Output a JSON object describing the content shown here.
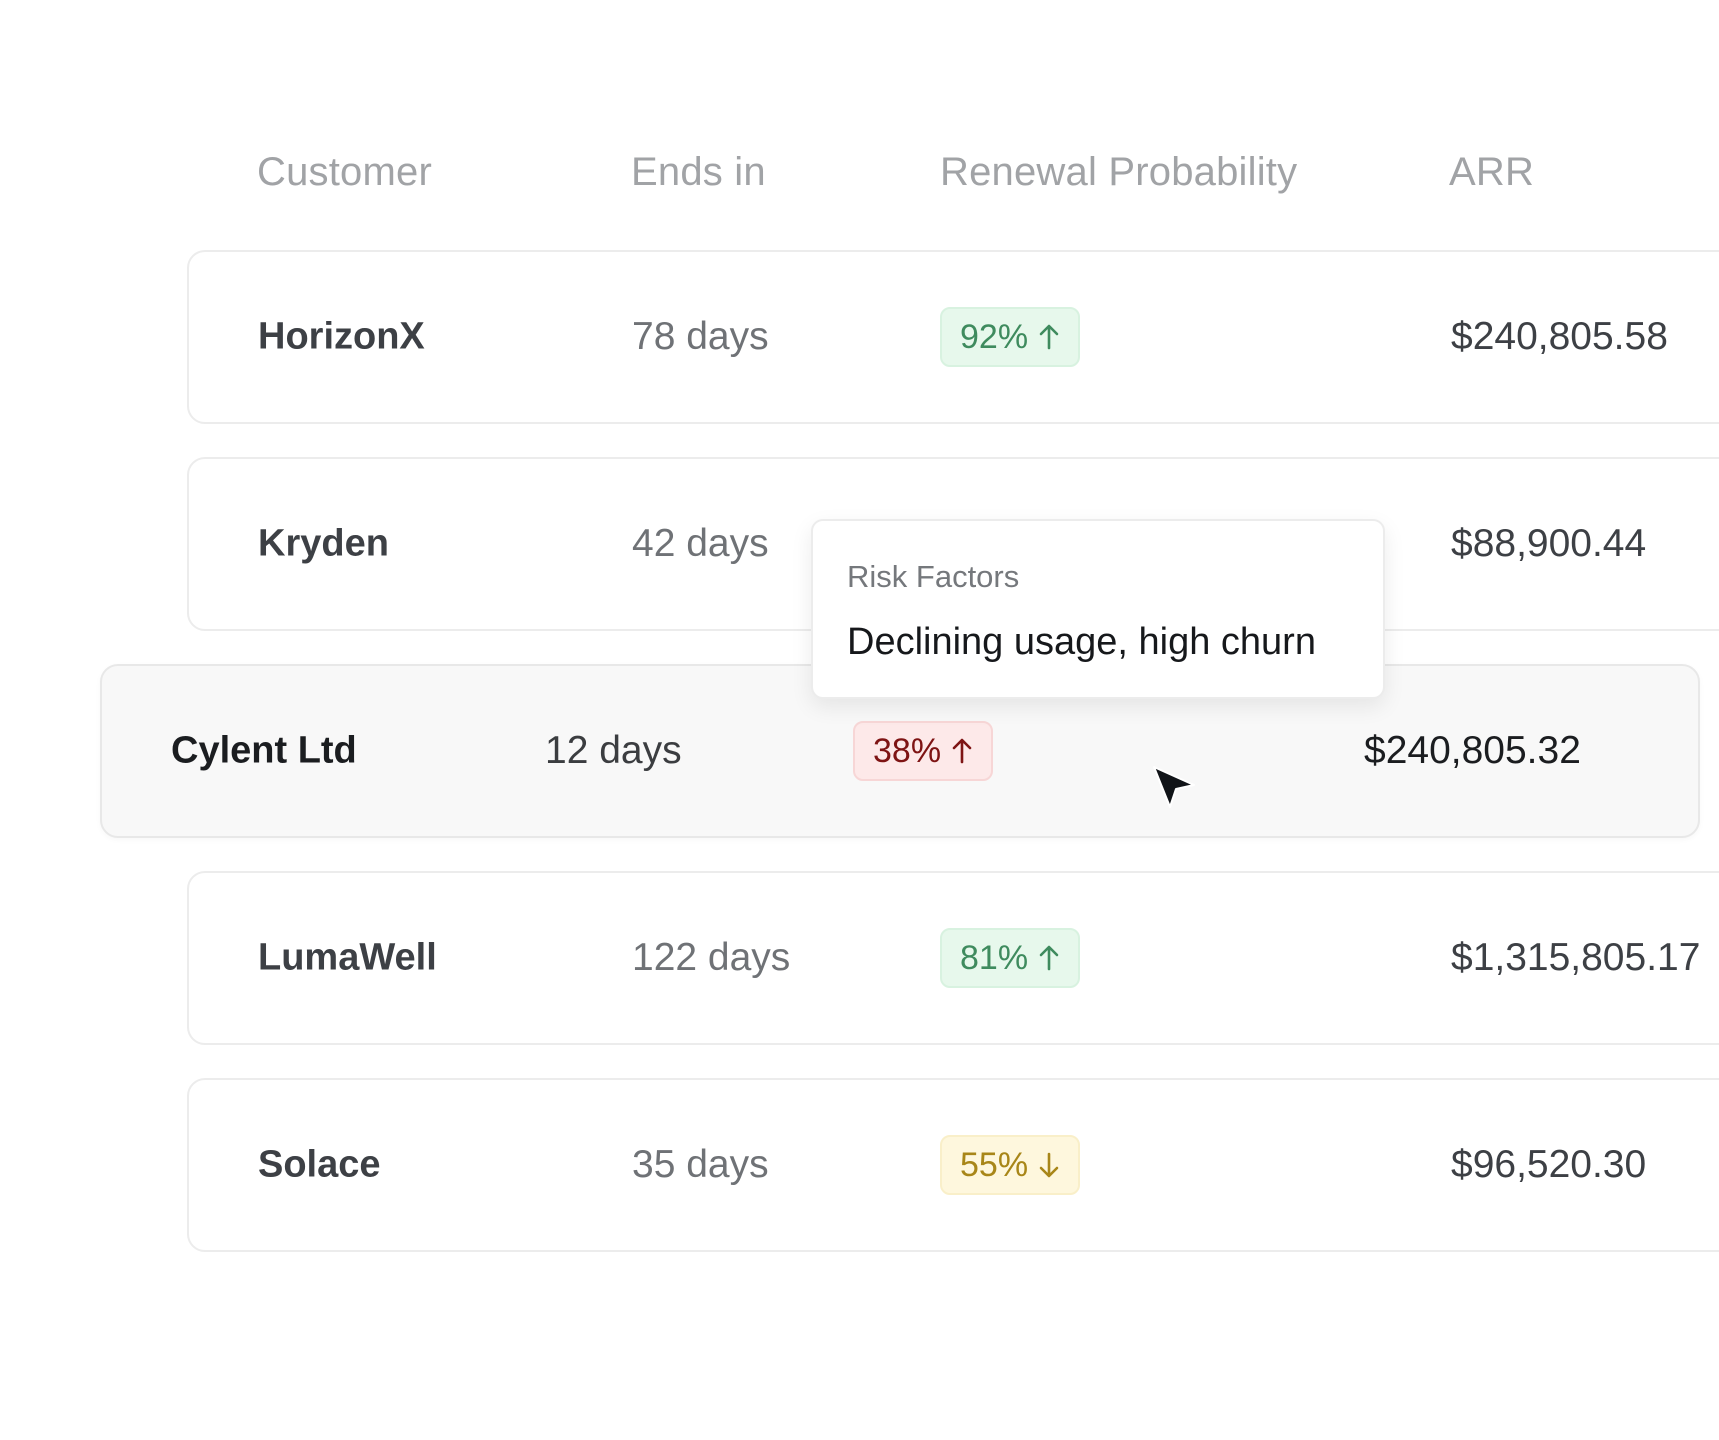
{
  "table": {
    "headers": {
      "customer": "Customer",
      "ends_in": "Ends in",
      "renewal_probability": "Renewal Probability",
      "arr": "ARR"
    },
    "rows": [
      {
        "customer": "HorizonX",
        "ends_in": "78 days",
        "probability": "92%",
        "trend": "up",
        "status": "green",
        "arr": "$240,805.58"
      },
      {
        "customer": "Kryden",
        "ends_in": "42 days",
        "arr": "$88,900.44"
      },
      {
        "customer": "Cylent Ltd",
        "ends_in": "12 days",
        "probability": "38%",
        "trend": "up",
        "status": "red",
        "arr": "$240,805.32",
        "highlighted": true
      },
      {
        "customer": "LumaWell",
        "ends_in": "122 days",
        "probability": "81%",
        "trend": "up",
        "status": "green",
        "arr": "$1,315,805.17"
      },
      {
        "customer": "Solace",
        "ends_in": "35 days",
        "probability": "55%",
        "trend": "down",
        "status": "yellow",
        "arr": "$96,520.30"
      }
    ]
  },
  "tooltip": {
    "title": "Risk Factors",
    "body": "Declining usage, high churn"
  },
  "colors": {
    "green": "#3f8b5e",
    "red": "#7e1414",
    "yellow": "#a88618",
    "header_text": "#a1a3a6",
    "row_border": "#ececec",
    "highlight_bg": "#f8f8f8"
  },
  "icons": {
    "trend_up": "arrow-up-icon",
    "trend_down": "arrow-down-icon",
    "cursor": "mouse-pointer-icon"
  }
}
